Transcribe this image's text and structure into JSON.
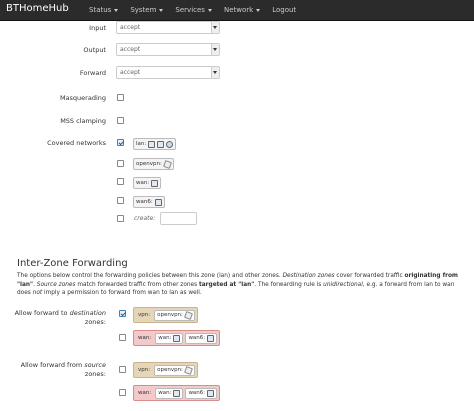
{
  "navbar": {
    "brand": "BTHomeHub",
    "items": [
      {
        "label": "Status",
        "dropdown": true
      },
      {
        "label": "System",
        "dropdown": true
      },
      {
        "label": "Services",
        "dropdown": true
      },
      {
        "label": "Network",
        "dropdown": true
      },
      {
        "label": "Logout",
        "dropdown": false
      }
    ]
  },
  "form": {
    "input": {
      "label": "Input",
      "value": "accept"
    },
    "output": {
      "label": "Output",
      "value": "accept"
    },
    "forward": {
      "label": "Forward",
      "value": "accept"
    },
    "masquerading": {
      "label": "Masquerading",
      "checked": false
    },
    "mss_clamping": {
      "label": "MSS clamping",
      "checked": false
    },
    "covered_networks": {
      "label": "Covered networks",
      "networks": [
        {
          "name": "lan:",
          "checked": true,
          "icons": [
            "network-icon",
            "wireless-icon",
            "globe-icon"
          ]
        },
        {
          "name": "openvpn:",
          "checked": false,
          "icons": [
            "pen-icon"
          ]
        },
        {
          "name": "wan:",
          "checked": false,
          "icons": [
            "network-icon"
          ]
        },
        {
          "name": "wan6:",
          "checked": false,
          "icons": [
            "network-icon"
          ]
        }
      ],
      "create_label": "create:"
    }
  },
  "inter_zone": {
    "title": "Inter-Zone Forwarding",
    "desc_1": "The options below control the forwarding policies between this zone (lan) and other zones. ",
    "desc_2_italic": "Destination zones",
    "desc_3": " cover forwarded traffic ",
    "desc_4_bold": "originating from \"lan\"",
    "desc_5": ". ",
    "desc_6_italic": "Source zones",
    "desc_7": " match forwarded traffic from other zones ",
    "desc_8_bold": "targeted at \"lan\"",
    "desc_9": ". The forwarding rule is ",
    "desc_10_italic": "unidirectional",
    "desc_11": ", e.g. a forward from lan to wan does ",
    "desc_12_italic": "not",
    "desc_13": " imply a permission to forward from wan to lan as well.",
    "allow_to_dest": {
      "label_prefix": "Allow forward to ",
      "label_italic": "destination",
      "label_suffix": "zones:"
    },
    "allow_from_src": {
      "label_prefix": "Allow forward from ",
      "label_italic": "source",
      "label_suffix": "zones:"
    },
    "vpn_zone": {
      "tag": "vpn:",
      "pill": "openvpn:"
    },
    "wan_zone": {
      "tag": "wan:",
      "pill1": "wan:",
      "pill2": "wan6:"
    }
  },
  "colors": {
    "navbar": "#2b2b2b",
    "vpn_zone": "#e6d6b8",
    "wan_zone": "#f3c9c9"
  }
}
